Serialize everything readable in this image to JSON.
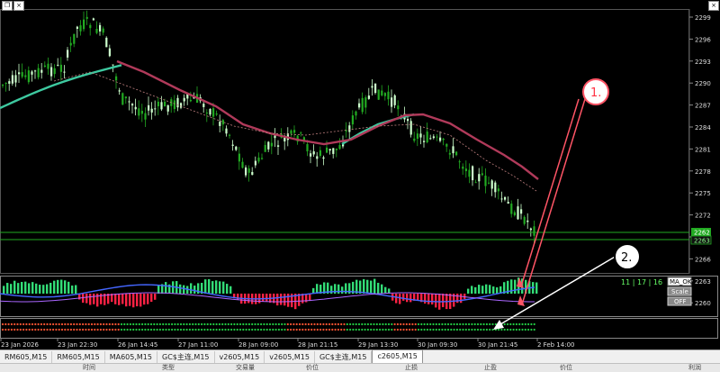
{
  "window": {
    "close_label": "×",
    "restore_label": "❐"
  },
  "price_axis": {
    "ticks": [
      "2299",
      "2296",
      "2293",
      "2290",
      "2287",
      "2284",
      "2281",
      "2278",
      "2275",
      "2272",
      "2269",
      "2266",
      "2263",
      "2260"
    ],
    "current_price_label": "2262",
    "line_price_label": "2263"
  },
  "time_axis": {
    "labels": [
      "23 Jan 2026",
      "23 Jan 22:30",
      "26 Jan 14:45",
      "27 Jan 11:00",
      "28 Jan 09:00",
      "28 Jan 21:15",
      "29 Jan 13:30",
      "30 Jan 09:30",
      "30 Jan 21:45",
      "2 Feb 14:00"
    ]
  },
  "annotations": {
    "label_1": "1.",
    "label_2": "2."
  },
  "indicator": {
    "readout": "11 | 17 | 16",
    "ma_ok_label": "MA_OK",
    "scale_label": "Scale",
    "off_label": "OFF"
  },
  "tabs": [
    {
      "label": "RM605,M15"
    },
    {
      "label": "RM605,M15"
    },
    {
      "label": "MA605,M15"
    },
    {
      "label": "GC$主连,M15"
    },
    {
      "label": "v2605,M15"
    },
    {
      "label": "v2605,M15"
    },
    {
      "label": "GC$主连,M15"
    },
    {
      "label": "c2605,M15",
      "active": true
    }
  ],
  "table_header": {
    "columns": [
      "时间",
      "类型",
      "交易量",
      "价位",
      "止损",
      "止盈",
      "价位",
      "利润"
    ]
  },
  "colors": {
    "up_candle": "#ccffcc",
    "down_candle": "#22aa22",
    "fast_ma": "#3ec9a0",
    "slow_ma": "#b03a5a",
    "hist_up": "#33dd77",
    "hist_down": "#ff2244",
    "osc_line": "#4466ff",
    "arrow_red": "#ff5566",
    "arrow_white": "#ffffff"
  }
}
